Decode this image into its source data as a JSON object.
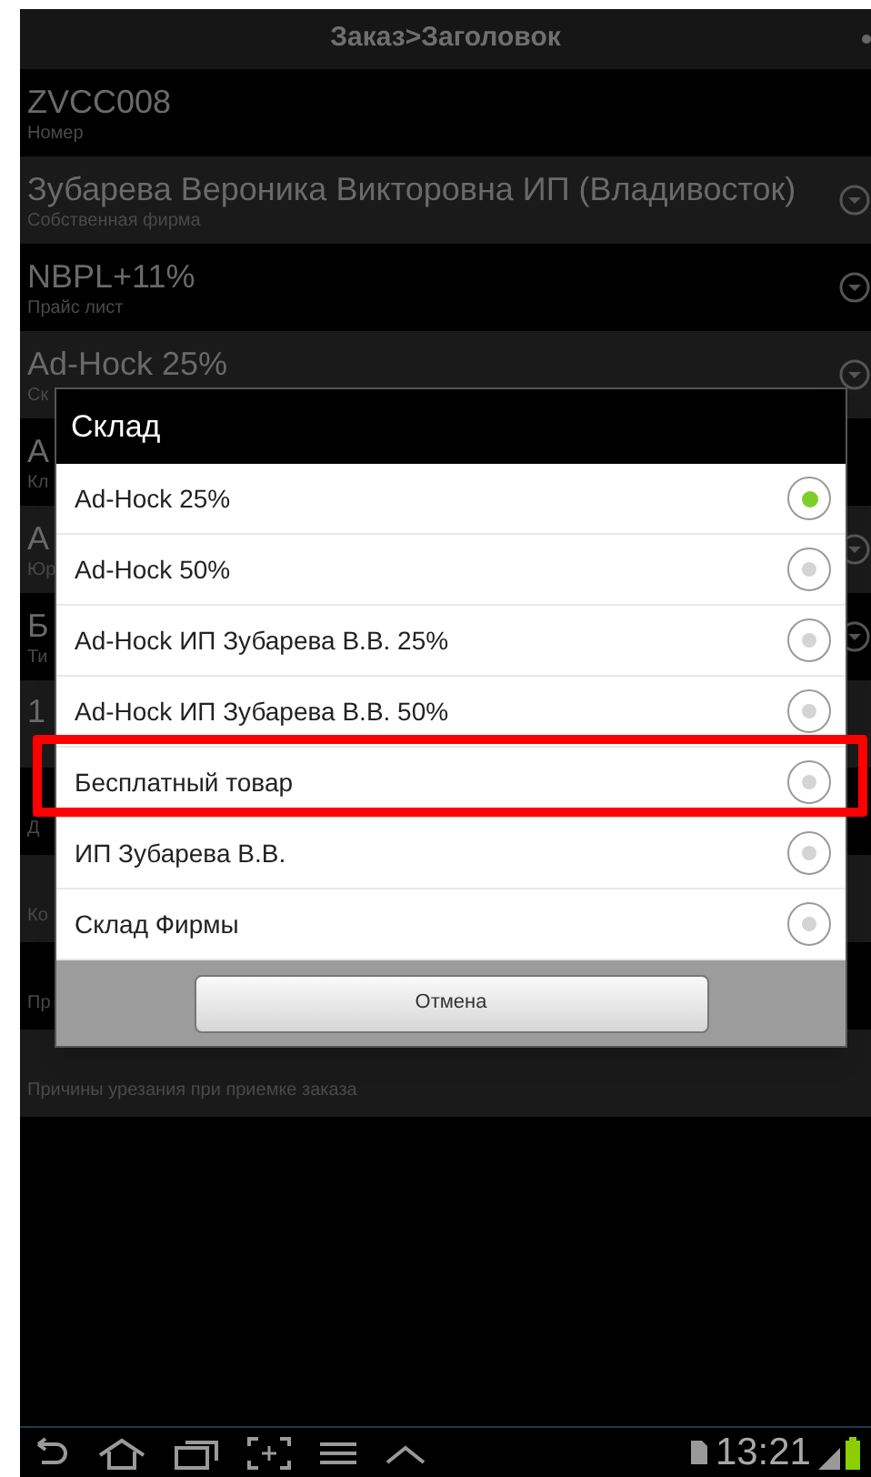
{
  "title_bar": {
    "title": "Заказ>Заголовок"
  },
  "fields": [
    {
      "value": "ZVCC008",
      "label": "Номер",
      "dropdown": false
    },
    {
      "value": "Зубарева Вероника Викторовна ИП (Владивосток)",
      "label": "Собственная фирма",
      "dropdown": true
    },
    {
      "value": "NBPL+11%",
      "label": "Прайс лист",
      "dropdown": true
    },
    {
      "value": "Ad-Hock 25%",
      "label": "Ск",
      "dropdown": true
    },
    {
      "value": "А",
      "label": "Кл",
      "dropdown": false
    },
    {
      "value": "А",
      "label": "Юр",
      "dropdown": true
    },
    {
      "value": "Б",
      "label": "Ти",
      "dropdown": true
    },
    {
      "value": "1",
      "dropdown": false
    },
    {
      "label": "Д",
      "dropdown": false
    },
    {
      "label": "Ко",
      "dropdown": false
    },
    {
      "label": "Пр",
      "dropdown": false
    },
    {
      "label": "Причины урезания при приемке заказа",
      "dropdown": false
    }
  ],
  "dialog": {
    "title": "Склад",
    "options": [
      {
        "label": "Ad-Hock 25%",
        "selected": true,
        "highlighted": false
      },
      {
        "label": "Ad-Hock 50%",
        "selected": false,
        "highlighted": false
      },
      {
        "label": "Ad-Hock ИП Зубарева В.В. 25%",
        "selected": false,
        "highlighted": false
      },
      {
        "label": "Ad-Hock ИП Зубарева В.В. 50%",
        "selected": false,
        "highlighted": false
      },
      {
        "label": "Бесплатный товар",
        "selected": false,
        "highlighted": true
      },
      {
        "label": "ИП Зубарева В.В.",
        "selected": false,
        "highlighted": false
      },
      {
        "label": "Склад Фирмы",
        "selected": false,
        "highlighted": false
      }
    ],
    "cancel_button": "Отмена"
  },
  "status_bar": {
    "time": "13:21"
  }
}
